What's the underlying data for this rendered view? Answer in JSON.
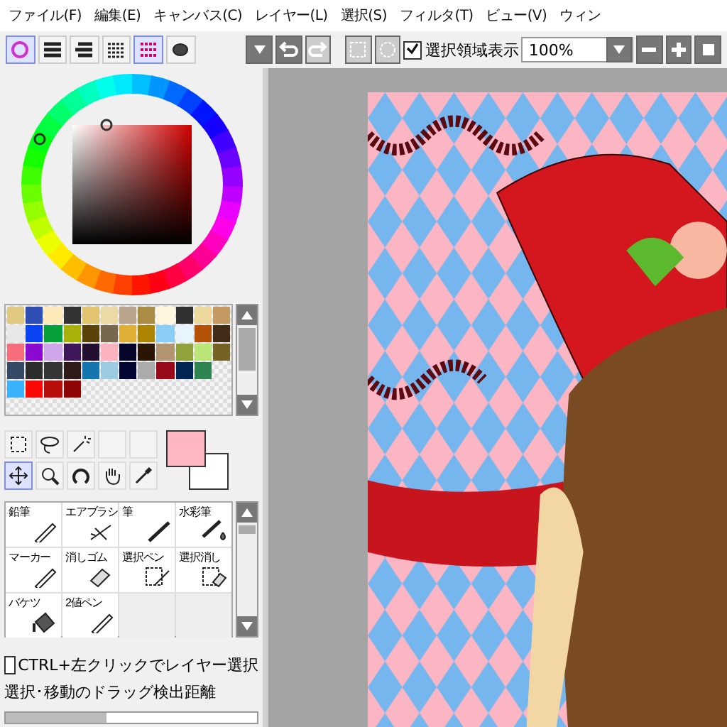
{
  "menu": [
    "ファイル(F)",
    "編集(E)",
    "キャンバス(C)",
    "レイヤー(L)",
    "選択(S)",
    "フィルタ(T)",
    "ビュー(V)",
    "ウィン"
  ],
  "panel_tabs": [
    {
      "kind": "wheel",
      "selected": true
    },
    {
      "kind": "bars",
      "selected": false
    },
    {
      "kind": "bars2",
      "selected": false
    },
    {
      "kind": "list",
      "selected": false
    },
    {
      "kind": "grid",
      "selected": true
    },
    {
      "kind": "blob",
      "selected": false
    }
  ],
  "toolbar": {
    "selection_display": {
      "label": "選択領域表示",
      "checked": true
    },
    "zoom": "100%"
  },
  "palette": [
    {
      "color": "#e2c982"
    },
    {
      "color": "#2f4fb4"
    },
    {
      "color": "#fdeab8"
    },
    {
      "color": "#333333"
    },
    {
      "color": "#e2c46e"
    },
    {
      "color": "#ecdaa6"
    },
    {
      "color": "#b9a58d"
    },
    {
      "color": "#aa8c45"
    },
    {
      "color": "#fff6e0"
    },
    {
      "color": "#303030"
    },
    {
      "color": "#ecd79d"
    },
    {
      "color": "#c49a62"
    },
    {
      "color": "#e8e8e8"
    },
    {
      "color": "#0a43f2"
    },
    {
      "color": "#06a03a"
    },
    {
      "color": "#a8b00a"
    },
    {
      "color": "#5a4308"
    },
    {
      "color": "#76684e"
    },
    {
      "color": "#dfb035"
    },
    {
      "color": "#ad8505"
    },
    {
      "color": "#8acdf6"
    },
    {
      "color": "#e6f4fe"
    },
    {
      "color": "#b35206"
    },
    {
      "color": "#432b1a"
    },
    {
      "color": "#f56d7b"
    },
    {
      "color": "#8a0ad0"
    },
    {
      "color": "#d0a6ea"
    },
    {
      "color": "#3d1758"
    },
    {
      "color": "#230f30"
    },
    {
      "color": "#fcb3bf"
    },
    {
      "color": "#05062a"
    },
    {
      "color": "#2a1505"
    },
    {
      "color": "#b19470"
    },
    {
      "color": "#90a23a"
    },
    {
      "color": "#bae677"
    },
    {
      "color": "#756325"
    },
    {
      "color": "#364a68"
    },
    {
      "color": "#2c2c2c"
    },
    {
      "color": "#353535"
    },
    {
      "color": "#2e1a18"
    },
    {
      "color": "#1576ad"
    },
    {
      "color": "#9ecbe4"
    },
    {
      "color": "#030633"
    },
    {
      "color": "#ababab"
    },
    {
      "color": "#99091a"
    },
    {
      "color": "#022554"
    },
    {
      "color": "#2f8552"
    },
    {
      "kind": "empty"
    },
    {
      "color": "#3ab2fb"
    },
    {
      "color": "#fb0a05"
    },
    {
      "color": "#b80e0a"
    },
    {
      "color": "#8f0503"
    }
  ],
  "tools": [
    {
      "kind": "rect-select",
      "selected": false
    },
    {
      "kind": "lasso",
      "selected": false
    },
    {
      "kind": "wand",
      "selected": false
    },
    {
      "kind": "empty",
      "selected": false
    },
    {
      "kind": "empty",
      "selected": false
    },
    {
      "kind": "move",
      "selected": true
    },
    {
      "kind": "zoom",
      "selected": false
    },
    {
      "kind": "rotate",
      "selected": false
    },
    {
      "kind": "hand",
      "selected": false
    },
    {
      "kind": "picker",
      "selected": false
    }
  ],
  "colors": {
    "primary": {
      "color": "#feb7c0"
    },
    "secondary": {
      "color": "#ffffff"
    }
  },
  "brushes": [
    {
      "name": "鉛筆",
      "kind": "pencil"
    },
    {
      "name": "エアブラシ",
      "kind": "air"
    },
    {
      "name": "筆",
      "kind": "brush"
    },
    {
      "name": "水彩筆",
      "kind": "water"
    },
    {
      "name": "マーカー",
      "kind": "pencil"
    },
    {
      "name": "消しゴム",
      "kind": "eraser"
    },
    {
      "name": "選択ペン",
      "kind": "selpen"
    },
    {
      "name": "選択消し",
      "kind": "selerase"
    },
    {
      "name": "バケツ",
      "kind": "bucket"
    },
    {
      "name": "2値ペン",
      "kind": "pencil"
    }
  ],
  "layer_select": {
    "label": "CTRL+左クリックでレイヤー選択",
    "checked": false
  },
  "drag_distance": {
    "label": "選択･移動のドラッグ検出距離",
    "level": 0.4
  }
}
